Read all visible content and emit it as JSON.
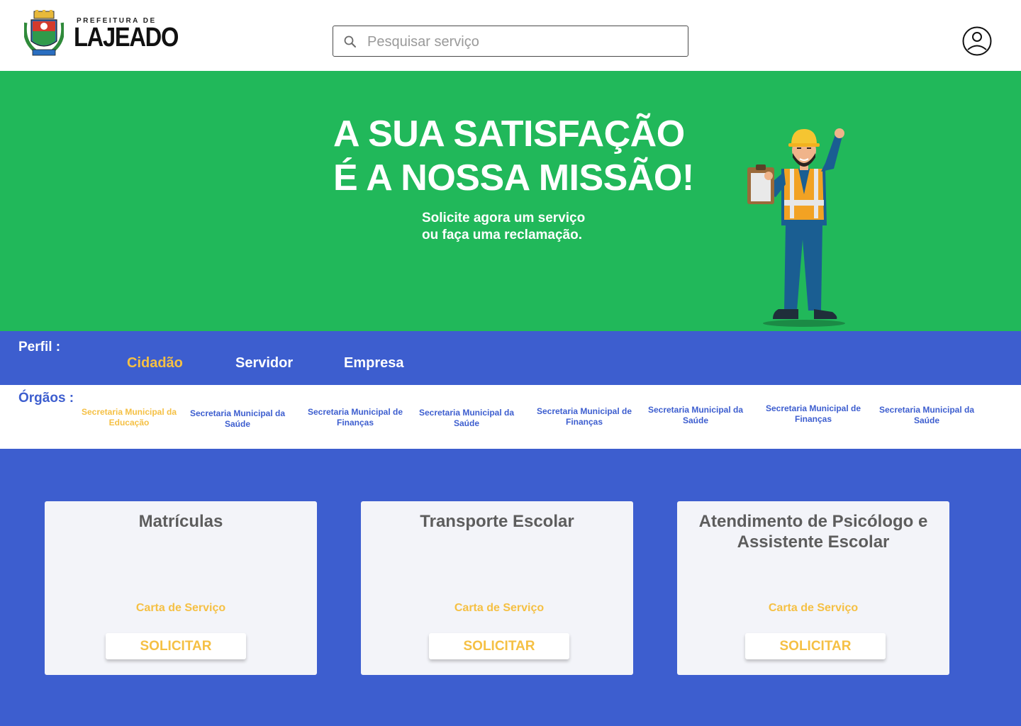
{
  "header": {
    "logo_small": "PREFEITURA DE",
    "logo_big": "LAJEADO",
    "search_placeholder": "Pesquisar serviço",
    "search_icon": "search-icon",
    "profile_icon": "user-circle-icon"
  },
  "hero": {
    "title_line1": "A SUA SATISFAÇÃO",
    "title_line2": "É A NOSSA MISSÃO!",
    "subtitle_line1": "Solicite agora um serviço",
    "subtitle_line2": "ou faça uma reclamação.",
    "background_color": "#21b85a"
  },
  "perfil": {
    "label": "Perfil :",
    "tabs": [
      {
        "label": "Cidadão",
        "active": true
      },
      {
        "label": "Servidor",
        "active": false
      },
      {
        "label": "Empresa",
        "active": false
      }
    ]
  },
  "orgaos": {
    "label": "Órgãos :",
    "items": [
      {
        "line1": "Secretaria Municipal da",
        "line2": "Educação",
        "active": true
      },
      {
        "line1": "Secretaria Municipal da",
        "line2": "Saúde",
        "active": false
      },
      {
        "line1": "Secretaria Municipal de",
        "line2": "Finanças",
        "active": false
      },
      {
        "line1": "Secretaria Municipal da",
        "line2": "Saúde",
        "active": false
      },
      {
        "line1": "Secretaria Municipal de",
        "line2": "Finanças",
        "active": false
      },
      {
        "line1": "Secretaria Municipal da",
        "line2": "Saúde",
        "active": false
      },
      {
        "line1": "Secretaria Municipal de",
        "line2": "Finanças",
        "active": false
      },
      {
        "line1": "Secretaria Municipal da",
        "line2": "Saúde",
        "active": false
      }
    ]
  },
  "services": [
    {
      "title": "Matrículas",
      "link": "Carta de Serviço",
      "button": "SOLICITAR"
    },
    {
      "title": "Transporte Escolar",
      "link": "Carta de Serviço",
      "button": "SOLICITAR"
    },
    {
      "title": "Atendimento de Psicólogo e Assistente Escolar",
      "link": "Carta de Serviço",
      "button": "SOLICITAR"
    }
  ],
  "colors": {
    "primary_blue": "#3d5ecf",
    "accent_yellow": "#f5c044",
    "hero_green": "#21b85a",
    "card_bg": "#f3f4f9"
  }
}
